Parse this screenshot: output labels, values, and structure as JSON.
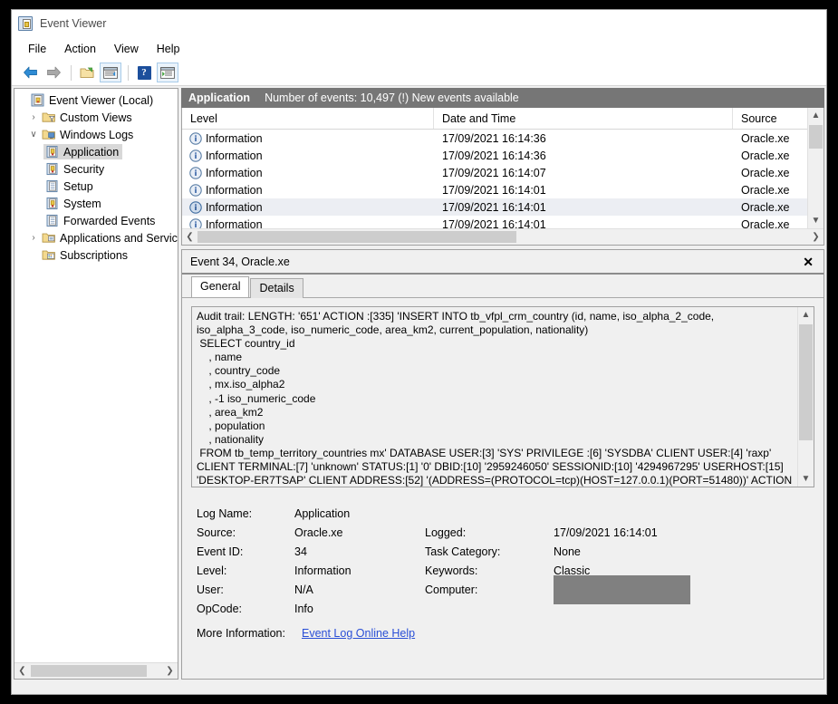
{
  "window": {
    "title": "Event Viewer",
    "icon": "event-viewer-icon"
  },
  "menubar": {
    "items": [
      {
        "label": "File"
      },
      {
        "label": "Action"
      },
      {
        "label": "View"
      },
      {
        "label": "Help"
      }
    ]
  },
  "toolbar": {
    "items": [
      {
        "name": "back-icon",
        "label": "Back"
      },
      {
        "name": "forward-icon",
        "label": "Forward"
      },
      {
        "name": "open-folder-icon",
        "label": "Show/Hide Console Tree"
      },
      {
        "name": "show-hide-tree-icon",
        "label": "Show/Hide Console Tree"
      },
      {
        "name": "help-icon",
        "label": "Help"
      },
      {
        "name": "show-hide-action-pane-icon",
        "label": "Show/Hide Action Pane"
      }
    ]
  },
  "sidebar": {
    "items": [
      {
        "label": "Event Viewer (Local)",
        "indent": 0,
        "chevron": "",
        "icon": "event-viewer-icon",
        "selected": false
      },
      {
        "label": "Custom Views",
        "indent": 1,
        "chevron": "›",
        "icon": "folder-filter-icon",
        "selected": false
      },
      {
        "label": "Windows Logs",
        "indent": 1,
        "chevron": "∨",
        "icon": "folder-logs-icon",
        "selected": false
      },
      {
        "label": "Application",
        "indent": 2,
        "chevron": "",
        "icon": "log-warning-icon",
        "selected": true
      },
      {
        "label": "Security",
        "indent": 2,
        "chevron": "",
        "icon": "log-warning-icon",
        "selected": false
      },
      {
        "label": "Setup",
        "indent": 2,
        "chevron": "",
        "icon": "log-icon",
        "selected": false
      },
      {
        "label": "System",
        "indent": 2,
        "chevron": "",
        "icon": "log-warning-icon",
        "selected": false
      },
      {
        "label": "Forwarded Events",
        "indent": 2,
        "chevron": "",
        "icon": "log-icon",
        "selected": false
      },
      {
        "label": "Applications and Service",
        "indent": 1,
        "chevron": "›",
        "icon": "folder-apps-icon",
        "selected": false
      },
      {
        "label": "Subscriptions",
        "indent": 1,
        "chevron": "",
        "icon": "subscriptions-icon",
        "selected": false
      }
    ]
  },
  "pane_header": {
    "title": "Application",
    "subtitle": "Number of events: 10,497 (!) New events available"
  },
  "event_list": {
    "columns": [
      "Level",
      "Date and Time",
      "Source"
    ],
    "rows": [
      {
        "level": "Information",
        "datetime": "17/09/2021 16:14:36",
        "source": "Oracle.xe",
        "selected": false
      },
      {
        "level": "Information",
        "datetime": "17/09/2021 16:14:36",
        "source": "Oracle.xe",
        "selected": false
      },
      {
        "level": "Information",
        "datetime": "17/09/2021 16:14:07",
        "source": "Oracle.xe",
        "selected": false
      },
      {
        "level": "Information",
        "datetime": "17/09/2021 16:14:01",
        "source": "Oracle.xe",
        "selected": false
      },
      {
        "level": "Information",
        "datetime": "17/09/2021 16:14:01",
        "source": "Oracle.xe",
        "selected": true
      },
      {
        "level": "Information",
        "datetime": "17/09/2021 16:14:01",
        "source": "Oracle.xe",
        "selected": false
      }
    ]
  },
  "detail": {
    "title": "Event 34, Oracle.xe",
    "close_label": "✕",
    "tabs": [
      {
        "label": "General",
        "active": true
      },
      {
        "label": "Details",
        "active": false
      }
    ],
    "description": "Audit trail: LENGTH: '651' ACTION :[335] 'INSERT INTO tb_vfpl_crm_country (id, name, iso_alpha_2_code, iso_alpha_3_code, iso_numeric_code, area_km2, current_population, nationality)\n SELECT country_id\n    , name\n    , country_code\n    , mx.iso_alpha2\n    , -1 iso_numeric_code\n    , area_km2\n    , population\n    , nationality\n FROM tb_temp_territory_countries mx' DATABASE USER:[3] 'SYS' PRIVILEGE :[6] 'SYSDBA' CLIENT USER:[4] 'raxp' CLIENT TERMINAL:[7] 'unknown' STATUS:[1] '0' DBID:[10] '2959246050' SESSIONID:[10] '4294967295' USERHOST:[15] 'DESKTOP-ER7TSAP' CLIENT ADDRESS:[52] '(ADDRESS=(PROTOCOL=tcp)(HOST=127.0.0.1)(PORT=51480))' ACTION",
    "properties_left": [
      {
        "label": "Log Name:",
        "value": "Application"
      },
      {
        "label": "Source:",
        "value": "Oracle.xe"
      },
      {
        "label": "Event ID:",
        "value": "34"
      },
      {
        "label": "Level:",
        "value": "Information"
      },
      {
        "label": "User:",
        "value": "N/A"
      },
      {
        "label": "OpCode:",
        "value": "Info"
      }
    ],
    "properties_right": [
      {
        "label": "Logged:",
        "value": "17/09/2021 16:14:01"
      },
      {
        "label": "Task Category:",
        "value": "None"
      },
      {
        "label": "Keywords:",
        "value": "Classic"
      },
      {
        "label": "Computer:",
        "value": "",
        "redacted": true
      }
    ],
    "more_information": {
      "label": "More Information:",
      "link_text": "Event Log Online Help"
    }
  }
}
